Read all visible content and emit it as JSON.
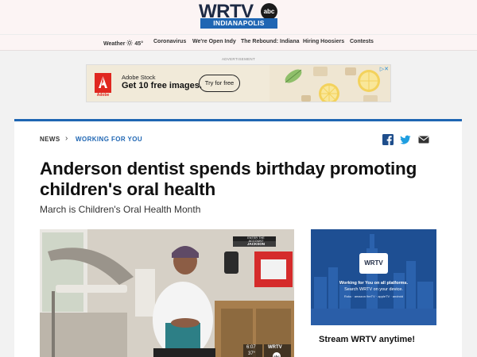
{
  "header": {
    "logo": "WRTV",
    "network_badge": "abc",
    "city": "INDIANAPOLIS",
    "nav": {
      "weather": "Weather",
      "temp": "45°",
      "items": [
        "Coronavirus",
        "We're Open Indy",
        "The Rebound: Indiana",
        "Hiring Hoosiers",
        "Contests"
      ]
    }
  },
  "ad": {
    "label": "ADVERTISEMENT",
    "brand": "Adobe",
    "title": "Adobe Stock",
    "subtitle": "Get 10 free images.",
    "button": "Try for free"
  },
  "article": {
    "breadcrumb": {
      "section": "NEWS",
      "subsection": "WORKING FOR YOU"
    },
    "headline": "Anderson dentist spends birthday promoting children's oral health",
    "subheadline": "March is Children's Oral Health Month"
  },
  "video": {
    "lower_label": "ENTER THE ACCOUNT",
    "lower_name": "JACKSON",
    "time": "6:07",
    "temp": "37°",
    "bug": "WRTV"
  },
  "promo": {
    "logo": "WRTV",
    "line1": "Working for You on all platforms.",
    "line2": "Search WRTV on your device.",
    "brands": "Roku · amazon fireTV · appleTV · android",
    "caption": "Stream WRTV anytime!"
  },
  "colors": {
    "accent_blue": "#1f66b3",
    "adobe_red": "#e0271f",
    "header_bg": "#fcf4f4"
  },
  "icons": {
    "weather": "sun-icon",
    "breadcrumb_separator": "chevron-right-icon",
    "share": [
      "facebook-icon",
      "twitter-icon",
      "email-icon"
    ],
    "ad_info": "ad-choices-icon"
  }
}
